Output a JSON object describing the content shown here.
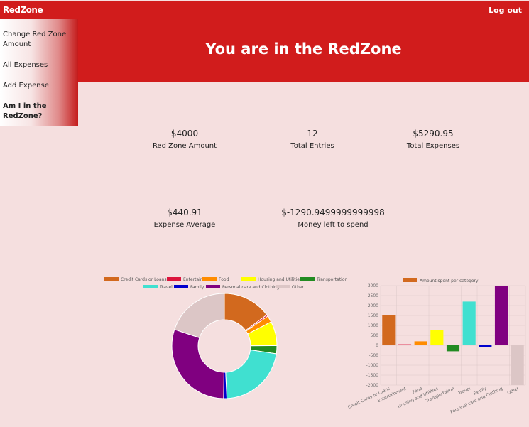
{
  "header": {
    "brand": "RedZone",
    "logout": "Log out"
  },
  "hero": {
    "title": "You are in the RedZone"
  },
  "sidebar": {
    "items": [
      {
        "label": "Change Red Zone Amount"
      },
      {
        "label": "All Expenses"
      },
      {
        "label": "Add Expense"
      },
      {
        "label": "Am I in the RedZone?"
      }
    ]
  },
  "stats": {
    "redzone_amount": {
      "value": "$4000",
      "label": "Red Zone Amount"
    },
    "total_entries": {
      "value": "12",
      "label": "Total Entries"
    },
    "total_expenses": {
      "value": "$5290.95",
      "label": "Total Expenses"
    },
    "expense_average": {
      "value": "$440.91",
      "label": "Expense Average"
    },
    "money_left": {
      "value": "$-1290.9499999999998",
      "label": "Money left to spend"
    }
  },
  "chart_data": [
    {
      "type": "pie",
      "variant": "doughnut",
      "legend_position": "top",
      "categories": [
        "Credit Cards or Loans",
        "Entertainment",
        "Food",
        "Housing and Utilities",
        "Transportation",
        "Travel",
        "Family",
        "Personal care and Clothing",
        "Other"
      ],
      "values": [
        1500,
        50,
        200,
        750,
        250,
        2200,
        100,
        3000,
        2000
      ],
      "colors": [
        "#d2691e",
        "#dc143c",
        "#ff8c00",
        "#ffff00",
        "#228b22",
        "#40e0d0",
        "#0000cd",
        "#800080",
        "#dcc6c6"
      ]
    },
    {
      "type": "bar",
      "legend_position": "top",
      "series": [
        {
          "name": "Amount spent per category",
          "values": [
            1500,
            50,
            200,
            750,
            -300,
            2200,
            -100,
            3000,
            -2000
          ]
        }
      ],
      "categories": [
        "Credit Cards or Loans",
        "Entertainment",
        "Food",
        "Housing and Utilities",
        "Transportation",
        "Travel",
        "Family",
        "Personal care and Clothing",
        "Other"
      ],
      "colors": [
        "#d2691e",
        "#dc143c",
        "#ff8c00",
        "#ffff00",
        "#228b22",
        "#40e0d0",
        "#0000cd",
        "#800080",
        "#dcc6c6"
      ],
      "ylim": [
        -2000,
        3000
      ],
      "yticks": [
        "3000",
        "2500",
        "2000",
        "1500",
        "1000",
        "500",
        "0",
        "-500",
        "-1000",
        "-1500",
        "-2000"
      ],
      "grid": true
    }
  ]
}
